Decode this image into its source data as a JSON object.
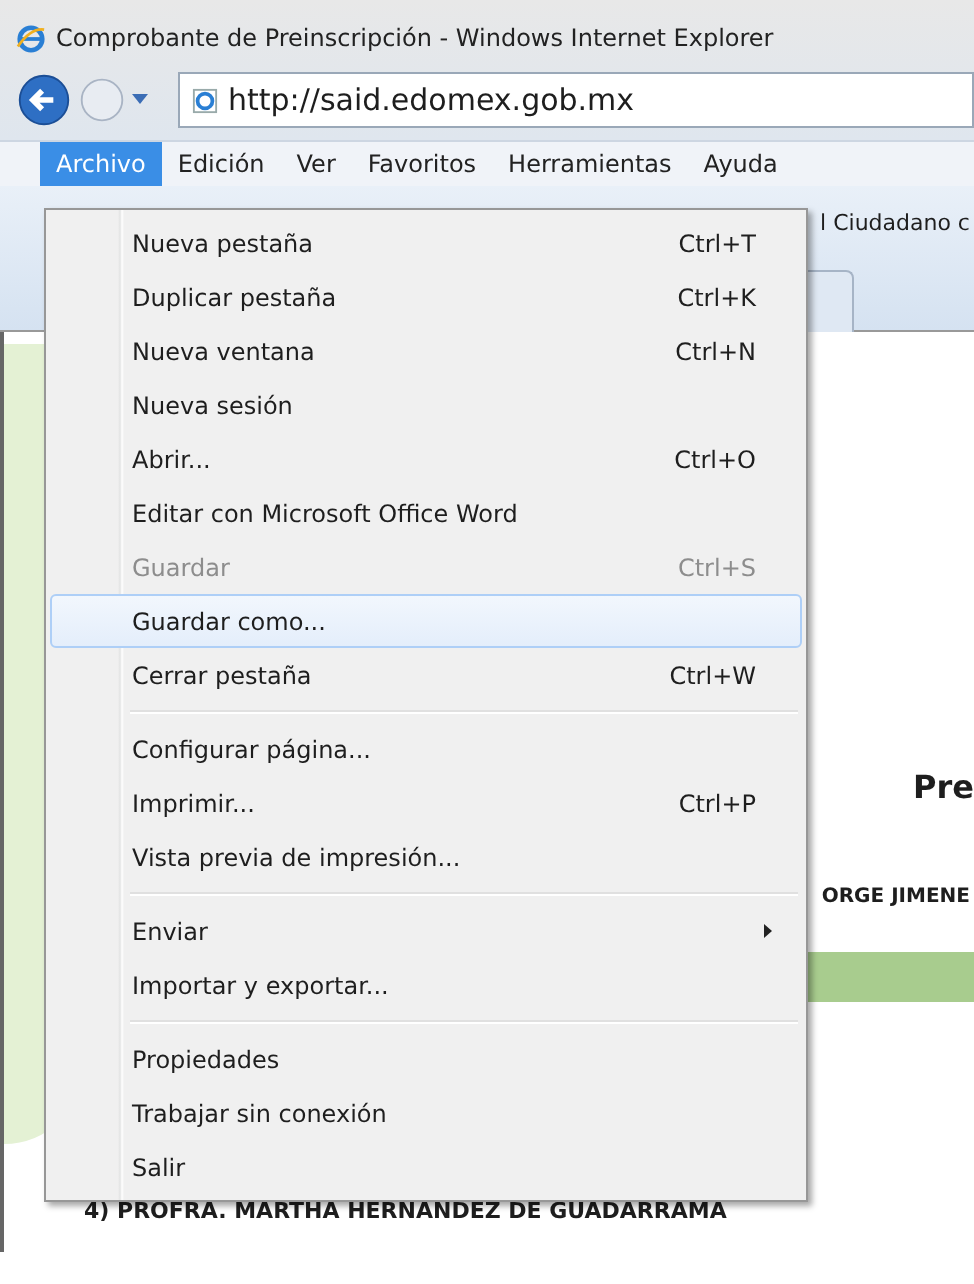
{
  "window": {
    "title": "Comprobante de Preinscripción - Windows Internet Explorer"
  },
  "address_bar": {
    "url": "http://said.edomex.gob.mx"
  },
  "menu_bar": [
    {
      "label": "Archivo",
      "selected": true
    },
    {
      "label": "Edición",
      "selected": false
    },
    {
      "label": "Ver",
      "selected": false
    },
    {
      "label": "Favoritos",
      "selected": false
    },
    {
      "label": "Herramientas",
      "selected": false
    },
    {
      "label": "Ayuda",
      "selected": false
    }
  ],
  "tab_strip": {
    "tab_text": "l Ciudadano c"
  },
  "page": {
    "heading": "Pre",
    "name_line": "ORGE JIMENE",
    "list_item": "4) PROFRA. MARTHA HERNANDEZ DE GUADARRAMA"
  },
  "file_menu": [
    {
      "kind": "item",
      "label": "Nueva pestaña",
      "shortcut": "Ctrl+T",
      "disabled": false,
      "selected": false
    },
    {
      "kind": "item",
      "label": "Duplicar pestaña",
      "shortcut": "Ctrl+K",
      "disabled": false,
      "selected": false
    },
    {
      "kind": "item",
      "label": "Nueva ventana",
      "shortcut": "Ctrl+N",
      "disabled": false,
      "selected": false
    },
    {
      "kind": "item",
      "label": "Nueva sesión",
      "disabled": false,
      "selected": false
    },
    {
      "kind": "item",
      "label": "Abrir...",
      "shortcut": "Ctrl+O",
      "disabled": false,
      "selected": false
    },
    {
      "kind": "item",
      "label": "Editar con Microsoft Office Word",
      "disabled": false,
      "selected": false
    },
    {
      "kind": "item",
      "label": "Guardar",
      "shortcut": "Ctrl+S",
      "disabled": true,
      "selected": false
    },
    {
      "kind": "item",
      "label": "Guardar como...",
      "disabled": false,
      "selected": true
    },
    {
      "kind": "item",
      "label": "Cerrar pestaña",
      "shortcut": "Ctrl+W",
      "disabled": false,
      "selected": false
    },
    {
      "kind": "separator"
    },
    {
      "kind": "item",
      "label": "Configurar página...",
      "disabled": false,
      "selected": false
    },
    {
      "kind": "item",
      "label": "Imprimir...",
      "shortcut": "Ctrl+P",
      "disabled": false,
      "selected": false
    },
    {
      "kind": "item",
      "label": "Vista previa de impresión...",
      "disabled": false,
      "selected": false
    },
    {
      "kind": "separator"
    },
    {
      "kind": "submenu",
      "label": "Enviar",
      "disabled": false,
      "selected": false
    },
    {
      "kind": "item",
      "label": "Importar y exportar...",
      "disabled": false,
      "selected": false
    },
    {
      "kind": "separator"
    },
    {
      "kind": "item",
      "label": "Propiedades",
      "disabled": false,
      "selected": false
    },
    {
      "kind": "item",
      "label": "Trabajar sin conexión",
      "disabled": false,
      "selected": false
    },
    {
      "kind": "item",
      "label": "Salir",
      "disabled": false,
      "selected": false
    }
  ]
}
